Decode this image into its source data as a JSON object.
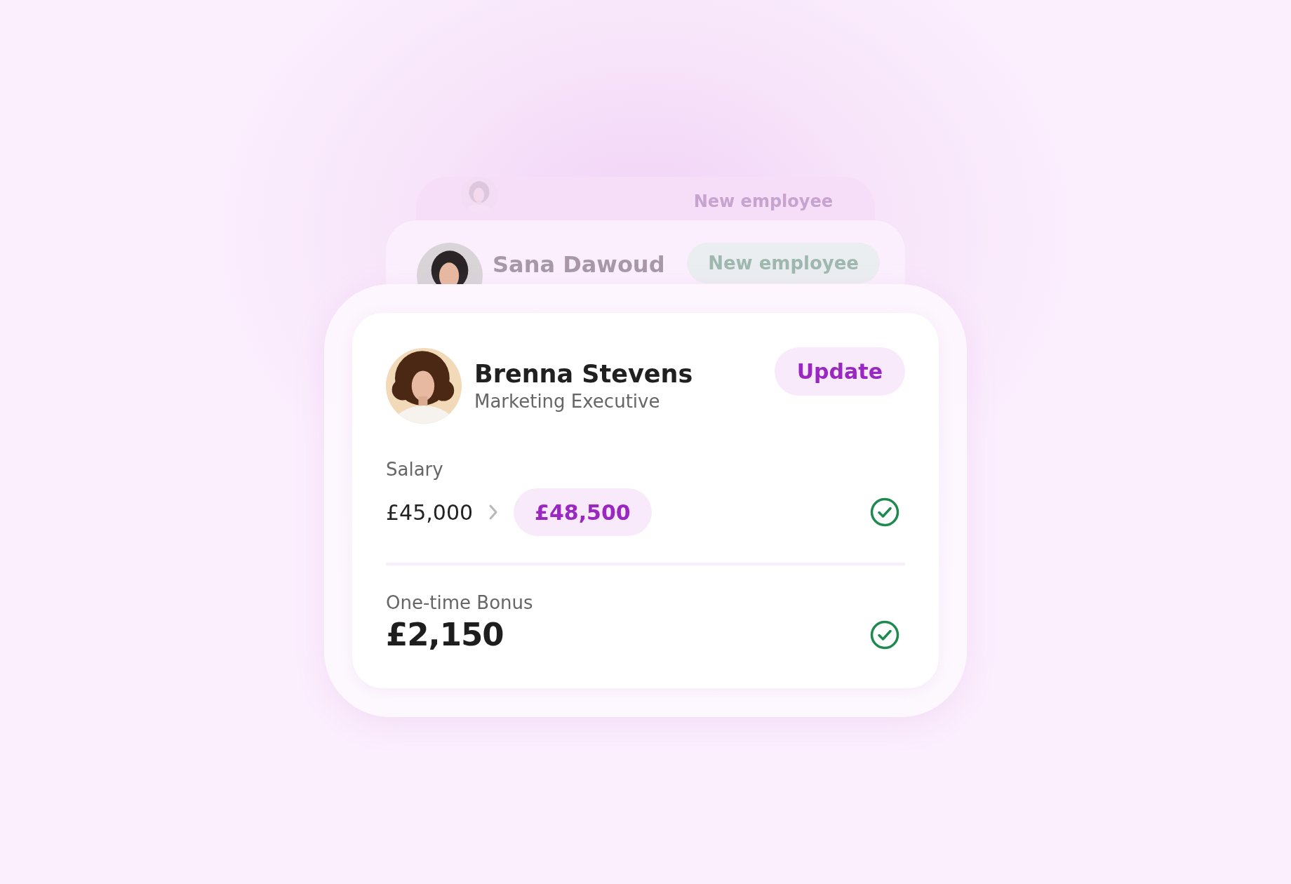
{
  "background_cards": [
    {
      "badge": "New employee"
    },
    {
      "name": "Sana Dawoud",
      "badge": "New employee"
    }
  ],
  "employee": {
    "name": "Brenna Stevens",
    "role": "Marketing Executive",
    "action": "Update"
  },
  "items": [
    {
      "kind": "change",
      "label": "Salary",
      "old_value": "£45,000",
      "new_value": "£48,500",
      "approved": true
    },
    {
      "kind": "amount",
      "label": "One-time Bonus",
      "value": "£2,150",
      "approved": true
    }
  ]
}
